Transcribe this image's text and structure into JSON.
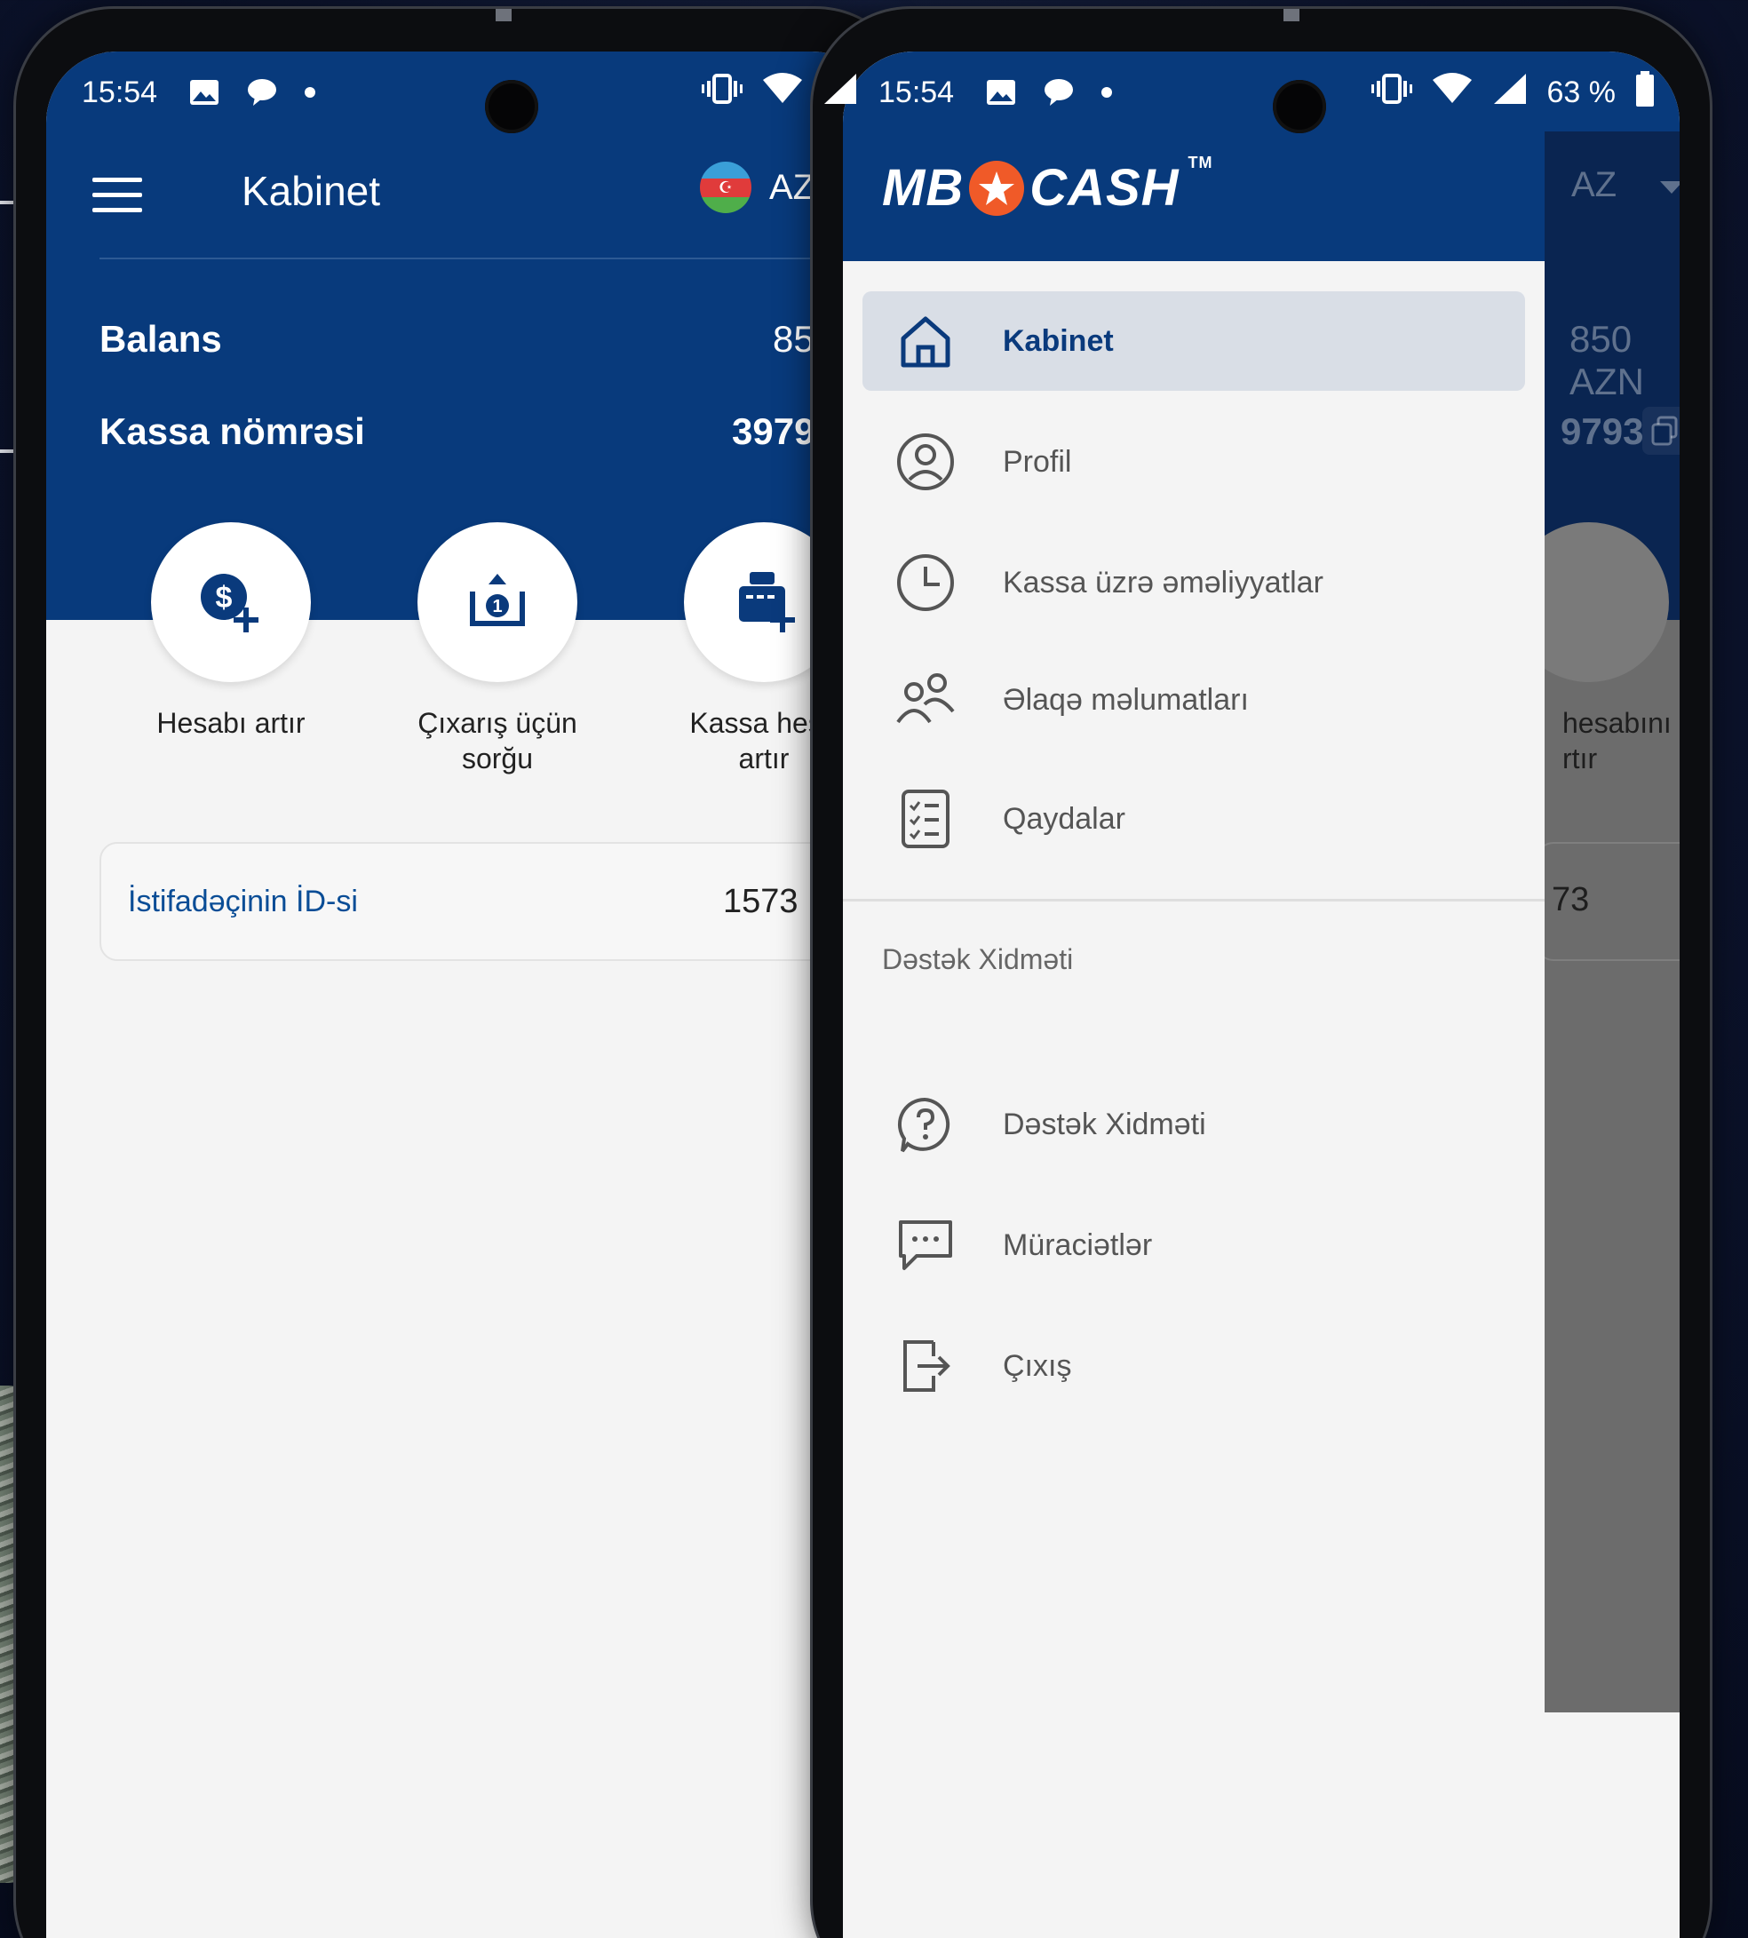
{
  "status": {
    "time": "15:54",
    "battery": "63 %"
  },
  "left": {
    "title": "Kabinet",
    "lang": "AZ",
    "balance_label": "Balans",
    "balance_value": "850",
    "kassa_label": "Kassa nömrəsi",
    "kassa_value": "3979",
    "actions": [
      {
        "label": "Hesabı artır"
      },
      {
        "label": "Çıxarış üçün\nsorğu"
      },
      {
        "label": "Kassa hesa\nartır"
      }
    ],
    "id_label": "İstifadəçinin İD-si",
    "id_value": "1573"
  },
  "right": {
    "logo_text_left": "MB",
    "logo_text_right": "CASH",
    "logo_tm": "TM",
    "bg_lang": "AZ",
    "bg_balance": "850 AZN",
    "bg_kassa": "9793",
    "bg_action_label": "hesabını\nrtır",
    "bg_id": "73",
    "menu": [
      {
        "label": "Kabinet",
        "icon": "home-icon",
        "active": true
      },
      {
        "label": "Profil",
        "icon": "user-circle-icon",
        "active": false
      },
      {
        "label": "Kassa üzrə əməliyyatlar",
        "icon": "clock-icon",
        "active": false
      },
      {
        "label": "Əlaqə məlumatları",
        "icon": "contacts-icon",
        "active": false
      },
      {
        "label": "Qaydalar",
        "icon": "checklist-icon",
        "active": false
      }
    ],
    "support_section": "Dəstək Xidməti",
    "support_menu": [
      {
        "label": "Dəstək Xidməti",
        "icon": "support-icon"
      },
      {
        "label": "Müraciətlər",
        "icon": "chat-icon"
      },
      {
        "label": "Çıxış",
        "icon": "logout-icon"
      }
    ]
  },
  "colors": {
    "brand_blue": "#083a7c",
    "accent_orange": "#f05a28"
  }
}
